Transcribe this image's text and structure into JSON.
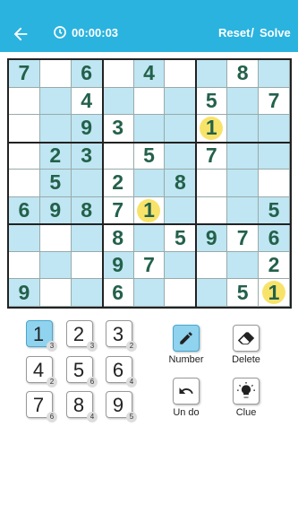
{
  "header": {
    "timer": "00:00:03",
    "reset_label": "Reset",
    "separator": "/",
    "solve_label": "Solve",
    "bg_color": "#2ab3df"
  },
  "board": {
    "selected_number": 1,
    "shade_color": "#bfe6f2",
    "highlight_color": "#f8e36a",
    "rows": [
      [
        "7",
        "",
        "6",
        "",
        "4",
        "",
        "",
        "8",
        ""
      ],
      [
        "",
        "",
        "4",
        "",
        "",
        "",
        "5",
        "",
        "7"
      ],
      [
        "",
        "",
        "9",
        "3",
        "",
        "",
        "1",
        "",
        ""
      ],
      [
        "",
        "2",
        "3",
        "",
        "5",
        "",
        "7",
        "",
        ""
      ],
      [
        "",
        "5",
        "",
        "2",
        "",
        "8",
        "",
        "",
        ""
      ],
      [
        "6",
        "9",
        "8",
        "7",
        "1",
        "",
        "",
        "",
        "5"
      ],
      [
        "",
        "",
        "",
        "8",
        "",
        "5",
        "9",
        "7",
        "6"
      ],
      [
        "",
        "",
        "",
        "9",
        "7",
        "",
        "",
        "",
        "2"
      ],
      [
        "9",
        "",
        "",
        "6",
        "",
        "",
        "",
        "5",
        "1"
      ]
    ],
    "shaded": [
      [
        1,
        0,
        1,
        0,
        1,
        0,
        1,
        0,
        1
      ],
      [
        0,
        1,
        0,
        1,
        0,
        1,
        0,
        1,
        0
      ],
      [
        0,
        1,
        1,
        0,
        1,
        1,
        0,
        1,
        1
      ],
      [
        0,
        1,
        1,
        0,
        0,
        1,
        0,
        1,
        1
      ],
      [
        0,
        1,
        1,
        0,
        1,
        1,
        0,
        1,
        0
      ],
      [
        1,
        1,
        1,
        0,
        0,
        1,
        0,
        1,
        1
      ],
      [
        1,
        0,
        1,
        0,
        1,
        0,
        1,
        0,
        1
      ],
      [
        0,
        1,
        0,
        1,
        0,
        1,
        0,
        1,
        0
      ],
      [
        1,
        0,
        1,
        0,
        1,
        0,
        1,
        0,
        0
      ]
    ]
  },
  "numpad": [
    {
      "digit": "1",
      "remaining": "3",
      "selected": true
    },
    {
      "digit": "2",
      "remaining": "3",
      "selected": false
    },
    {
      "digit": "3",
      "remaining": "2",
      "selected": false
    },
    {
      "digit": "4",
      "remaining": "2",
      "selected": false
    },
    {
      "digit": "5",
      "remaining": "6",
      "selected": false
    },
    {
      "digit": "6",
      "remaining": "4",
      "selected": false
    },
    {
      "digit": "7",
      "remaining": "6",
      "selected": false
    },
    {
      "digit": "8",
      "remaining": "4",
      "selected": false
    },
    {
      "digit": "9",
      "remaining": "5",
      "selected": false
    }
  ],
  "tools": {
    "number_label": "Number",
    "delete_label": "Delete",
    "undo_label": "Un do",
    "clue_label": "Clue",
    "pencil_icon": "pencil-icon",
    "eraser_icon": "eraser-icon",
    "undo_icon": "undo-icon",
    "bulb_icon": "lightbulb-icon"
  }
}
